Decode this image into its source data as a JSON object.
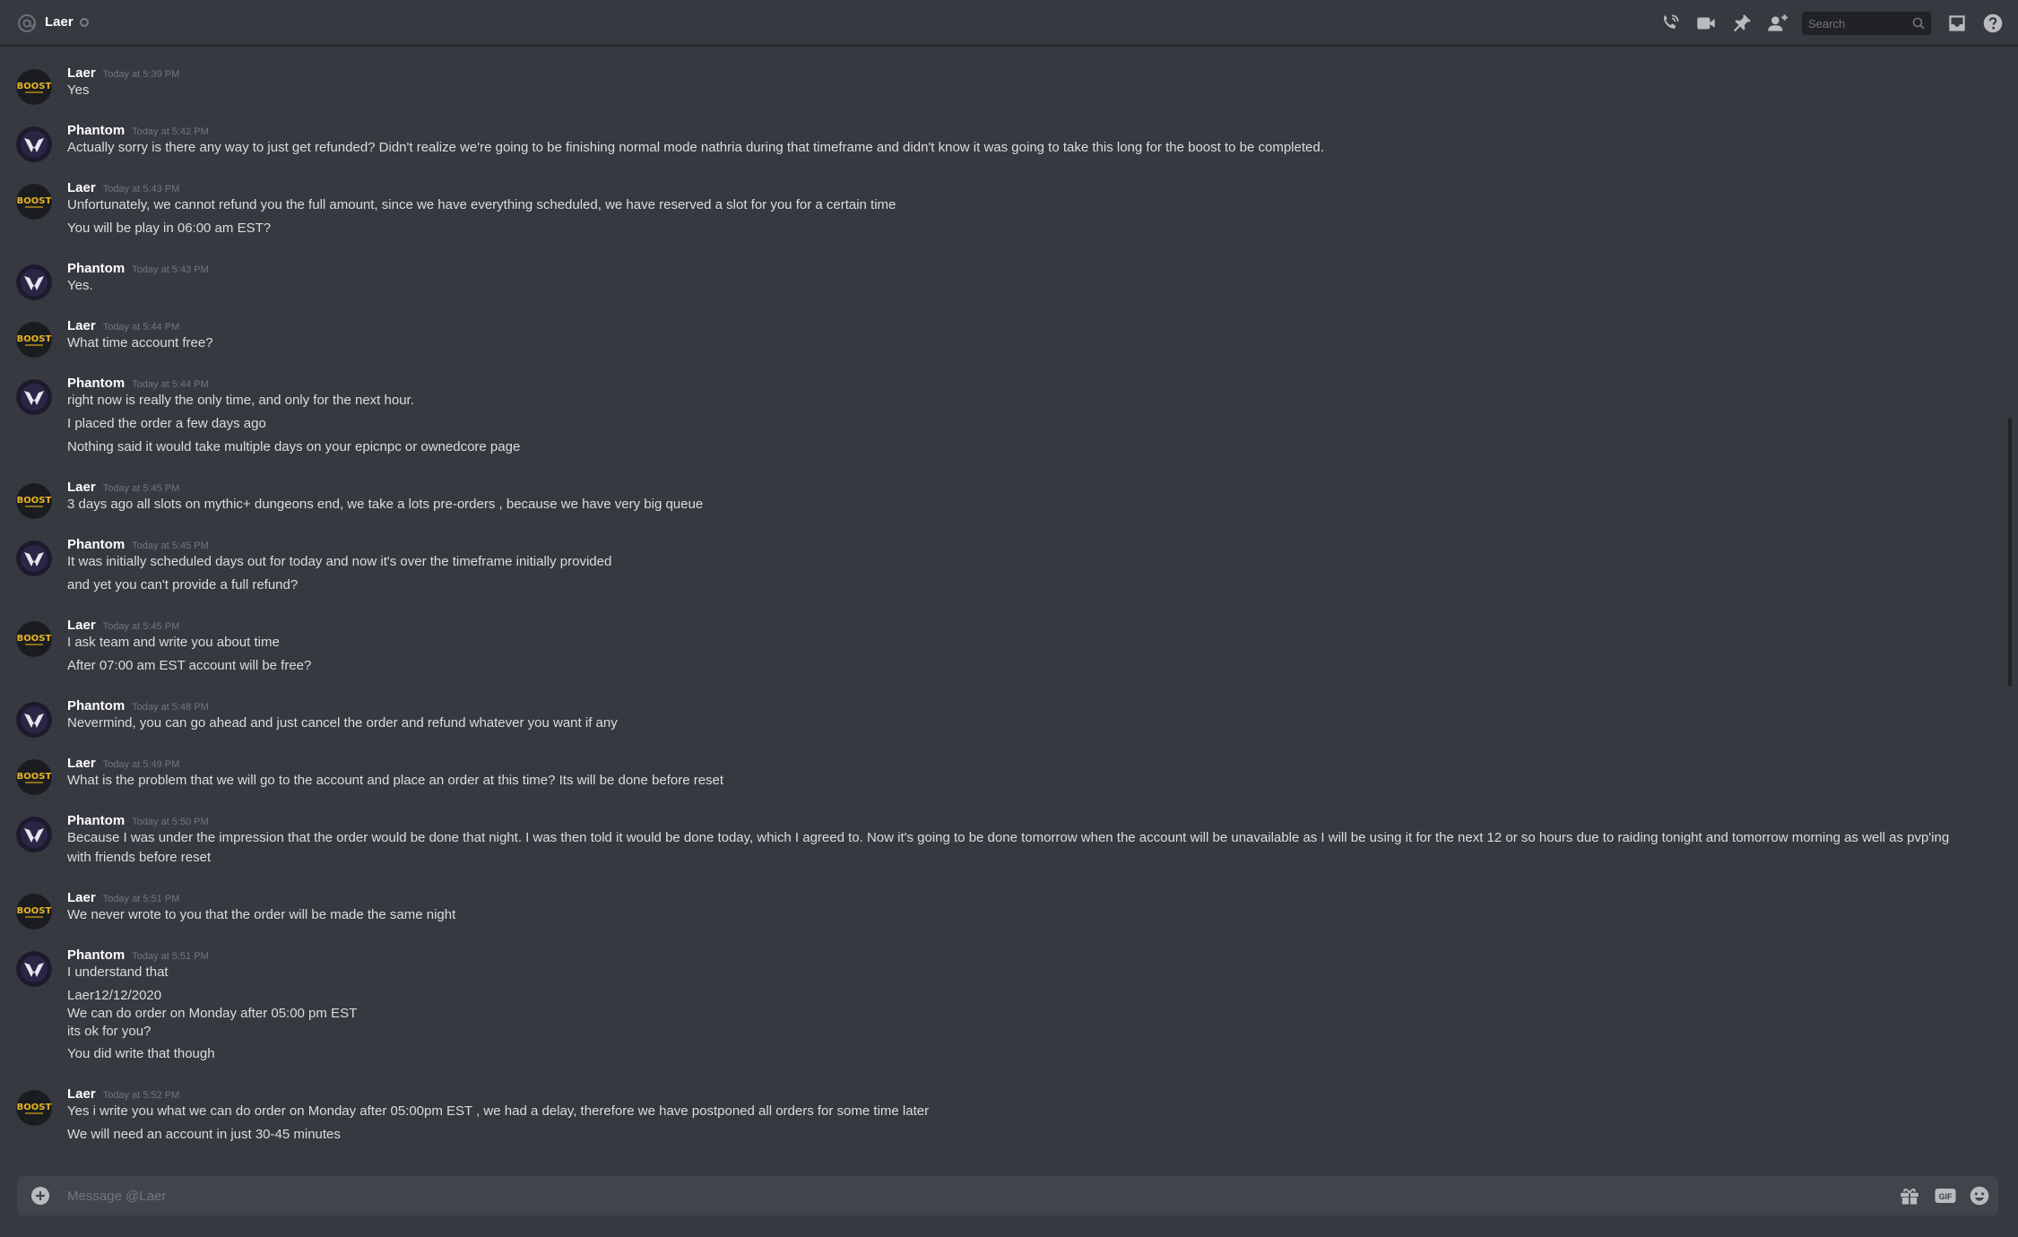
{
  "header": {
    "channel_name": "Laer",
    "search_placeholder": "Search"
  },
  "composer": {
    "placeholder": "Message @Laer"
  },
  "icons": {
    "header_left": "at-icon",
    "status": "offline-status-icon",
    "call": "start-voice-call-icon",
    "video": "start-video-call-icon",
    "pin": "pinned-messages-icon",
    "add_friend": "add-friends-to-dm-icon",
    "search": "search-icon",
    "inbox": "inbox-icon",
    "help": "help-icon",
    "composer_add": "upload-plus-icon",
    "gift": "gift-icon",
    "gif": "gif-icon",
    "emoji": "emoji-icon"
  },
  "colors": {
    "background": "#36393f",
    "composer_bg": "#40444b",
    "text": "#dcddde",
    "muted": "#72767d",
    "username": "#ffffff"
  },
  "messages": [
    {
      "author": "Laer",
      "avatar": "boost-logo",
      "time": "Today at 5:39 PM",
      "lines": [
        "Yes"
      ]
    },
    {
      "author": "Phantom",
      "avatar": "phantom-logo",
      "time": "Today at 5:42 PM",
      "lines": [
        "Actually sorry is there any way to just get refunded? Didn't realize we're going to be finishing normal mode nathria during that timeframe and didn't know it was going to take this long for the boost to be completed."
      ]
    },
    {
      "author": "Laer",
      "avatar": "boost-logo",
      "time": "Today at 5:43 PM",
      "lines": [
        "Unfortunately, we cannot refund you the full amount, since we have everything scheduled, we have reserved a slot for you for a certain time",
        "You will be play in 06:00 am EST?"
      ]
    },
    {
      "author": "Phantom",
      "avatar": "phantom-logo",
      "time": "Today at 5:43 PM",
      "lines": [
        "Yes."
      ]
    },
    {
      "author": "Laer",
      "avatar": "boost-logo",
      "time": "Today at 5:44 PM",
      "lines": [
        "What time account free?"
      ]
    },
    {
      "author": "Phantom",
      "avatar": "phantom-logo",
      "time": "Today at 5:44 PM",
      "lines": [
        "right now is really the only time, and only for the next hour.",
        "I placed the order a few days ago",
        "Nothing said it would take multiple days on your epicnpc or ownedcore page"
      ]
    },
    {
      "author": "Laer",
      "avatar": "boost-logo",
      "time": "Today at 5:45 PM",
      "lines": [
        "3 days ago all slots on mythic+ dungeons end, we take a lots pre-orders , because we have very big queue"
      ]
    },
    {
      "author": "Phantom",
      "avatar": "phantom-logo",
      "time": "Today at 5:45 PM",
      "lines": [
        "It was initially scheduled days out for today and now it's over the timeframe initially provided",
        "and yet you can't provide a full refund?"
      ]
    },
    {
      "author": "Laer",
      "avatar": "boost-logo",
      "time": "Today at 5:45 PM",
      "lines": [
        "I ask team and write you about time",
        "After 07:00 am EST account will be free?"
      ]
    },
    {
      "author": "Phantom",
      "avatar": "phantom-logo",
      "time": "Today at 5:48 PM",
      "lines": [
        "Nevermind, you can go ahead and just cancel the order and refund whatever you want if any"
      ]
    },
    {
      "author": "Laer",
      "avatar": "boost-logo",
      "time": "Today at 5:49 PM",
      "lines": [
        "What is the problem that we will go to the account and place an order at this time? Its will be done before reset"
      ]
    },
    {
      "author": "Phantom",
      "avatar": "phantom-logo",
      "time": "Today at 5:50 PM",
      "lines": [
        "Because I was under the impression that the order would be done that night. I was then told it would be done today, which I agreed to. Now it's going to be done tomorrow when the account will be unavailable as I will be using it for the next 12 or so hours due to raiding tonight and tomorrow morning as well as pvp'ing with friends before reset"
      ]
    },
    {
      "author": "Laer",
      "avatar": "boost-logo",
      "time": "Today at 5:51 PM",
      "lines": [
        "We never wrote to you that the order will be made the same night"
      ]
    },
    {
      "author": "Phantom",
      "avatar": "phantom-logo",
      "time": "Today at 5:51 PM",
      "lines": [
        "I understand that",
        "Laer12/12/2020",
        "We can do order on Monday after 05:00 pm EST",
        "its ok for you?",
        "You did write that though"
      ]
    },
    {
      "author": "Laer",
      "avatar": "boost-logo",
      "time": "Today at 5:52 PM",
      "lines": [
        "Yes i write you what we can do order on Monday after 05:00pm EST , we had a delay, therefore we have postponed all orders for some time later",
        "We will need an account in just 30-45 minutes"
      ]
    }
  ]
}
